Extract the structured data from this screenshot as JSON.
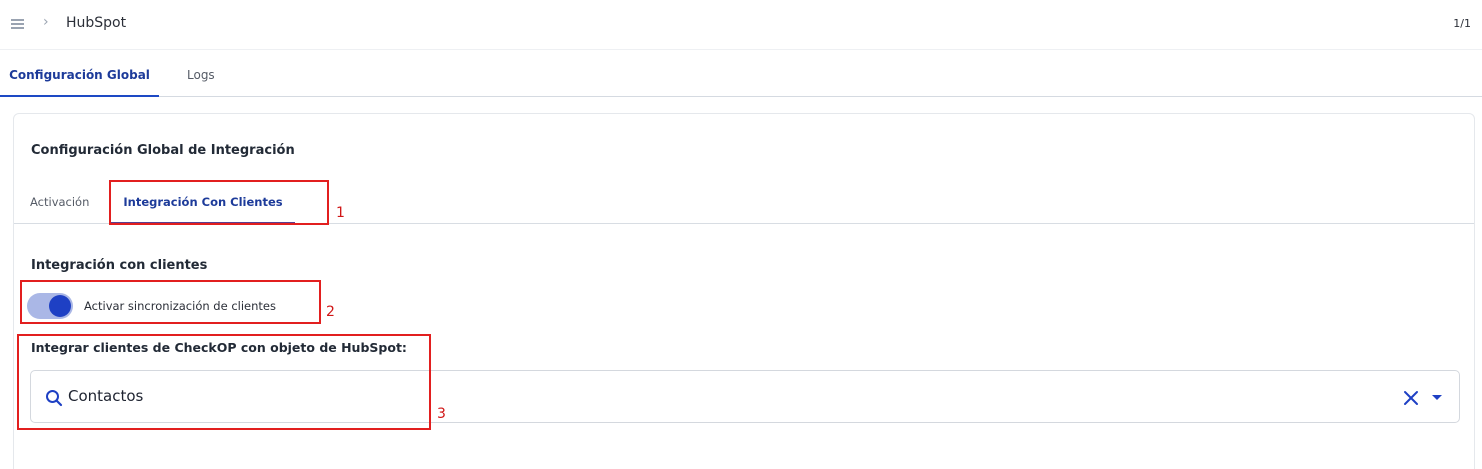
{
  "breadcrumb": {
    "menu_icon": "hamburger-icon",
    "separator": "›",
    "title": "HubSpot"
  },
  "page_indicator": "1/1",
  "main_tabs": [
    {
      "label": "Configuración Global",
      "active": true
    },
    {
      "label": "Logs",
      "active": false
    }
  ],
  "card": {
    "title": "Configuración Global de Integración",
    "sub_tabs": [
      {
        "label": "Activación",
        "active": false
      },
      {
        "label": "Integración Con Clientes",
        "active": true
      }
    ],
    "section_title": "Integración con clientes",
    "sync_toggle": {
      "label": "Activar sincronización de clientes",
      "on": true
    },
    "object_select": {
      "label": "Integrar clientes de CheckOP con objeto de HubSpot:",
      "value": "Contactos",
      "search_icon": "search-icon",
      "clear_icon": "close-icon",
      "dropdown_icon": "caret-down-icon"
    },
    "faded_text": "............................"
  },
  "annotations": [
    "1",
    "2",
    "3"
  ],
  "colors": {
    "accent": "#1e40c4",
    "annotation": "#e21f1f",
    "toggle_track": "#aab7e6"
  }
}
